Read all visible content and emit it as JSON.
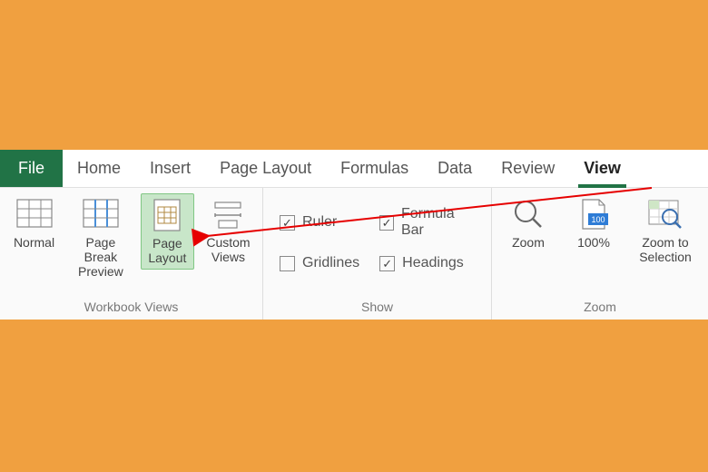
{
  "tabs": {
    "file": "File",
    "home": "Home",
    "insert": "Insert",
    "pageLayout": "Page Layout",
    "formulas": "Formulas",
    "data": "Data",
    "review": "Review",
    "view": "View"
  },
  "groups": {
    "workbookViews": {
      "label": "Workbook Views",
      "normal": "Normal",
      "pageBreakPreview": "Page Break\nPreview",
      "pageLayout": "Page\nLayout",
      "customViews": "Custom\nViews"
    },
    "show": {
      "label": "Show",
      "ruler": {
        "label": "Ruler",
        "checked": true
      },
      "formulaBar": {
        "label": "Formula Bar",
        "checked": true
      },
      "gridlines": {
        "label": "Gridlines",
        "checked": false
      },
      "headings": {
        "label": "Headings",
        "checked": true
      }
    },
    "zoom": {
      "label": "Zoom",
      "zoom": "Zoom",
      "hundred": "100%",
      "toSelection": "Zoom to\nSelection"
    }
  }
}
